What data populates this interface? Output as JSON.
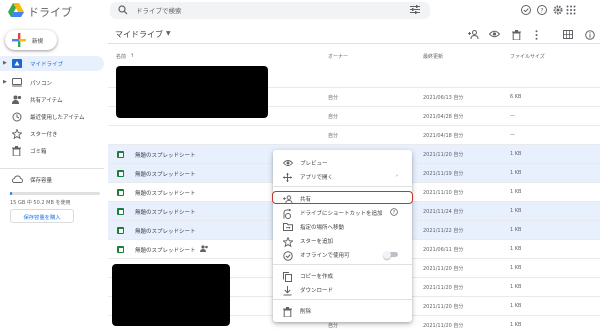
{
  "header": {
    "app_title": "ドライブ",
    "search_placeholder": "ドライブで検索"
  },
  "sidebar": {
    "new_label": "新規",
    "items": [
      {
        "label": "マイドライブ",
        "icon": "my-drive-icon",
        "active": true
      },
      {
        "label": "パソコン",
        "icon": "computer-icon"
      },
      {
        "label": "共有アイテム",
        "icon": "shared-icon"
      },
      {
        "label": "最近使用したアイテム",
        "icon": "clock-icon"
      },
      {
        "label": "スター付き",
        "icon": "star-icon"
      },
      {
        "label": "ゴミ箱",
        "icon": "trash-icon"
      }
    ],
    "storage_label": "保存容量",
    "storage_text": "15 GB 中 50.2 MB を使用",
    "storage_fraction": 0.003,
    "buy_label": "保存容量を購入"
  },
  "main": {
    "title": "マイドライブ",
    "columns": {
      "name": "名前",
      "owner": "オーナー",
      "modified": "最終更新",
      "size": "ファイルサイズ"
    },
    "rows": [
      {
        "name": "",
        "owner": "",
        "modified": "",
        "size": ""
      },
      {
        "name": "",
        "owner": "自分",
        "modified": "2021/06/13 自分",
        "size": "6 KB"
      },
      {
        "name": "",
        "owner": "自分",
        "modified": "2021/04/28 自分",
        "size": "—"
      },
      {
        "name": "",
        "owner": "自分",
        "modified": "2021/04/18 自分",
        "size": "—"
      },
      {
        "name": "無題のスプレッドシート",
        "owner": "自分",
        "modified": "2021/11/20 自分",
        "size": "1 KB",
        "selected": true
      },
      {
        "name": "無題のスプレッドシート",
        "owner": "自分",
        "modified": "2021/11/19 自分",
        "size": "1 KB",
        "selected": true
      },
      {
        "name": "無題のスプレッドシート",
        "owner": "自分",
        "modified": "2021/11/10 自分",
        "size": "1 KB"
      },
      {
        "name": "無題のスプレッドシート",
        "owner": "自分",
        "modified": "2021/11/24 自分",
        "size": "1 KB",
        "selected": true
      },
      {
        "name": "無題のスプレッドシート",
        "owner": "自分",
        "modified": "2021/11/22 自分",
        "size": "1 KB",
        "selected": true
      },
      {
        "name": "無題のスプレッドシート",
        "owner": "自分",
        "modified": "2021/06/11 自分",
        "size": "1 KB",
        "shared": true
      },
      {
        "name": "",
        "owner": "自分",
        "modified": "2021/11/20 自分",
        "size": "1 KB"
      },
      {
        "name": "",
        "owner": "自分",
        "modified": "2021/11/20 自分",
        "size": "1 KB"
      },
      {
        "name": "",
        "owner": "自分",
        "modified": "2021/11/20 自分",
        "size": "1 KB"
      },
      {
        "name": "",
        "owner": "自分",
        "modified": "2021/11/20 自分",
        "size": "1 KB"
      }
    ]
  },
  "context_menu": {
    "items": [
      {
        "label": "プレビュー",
        "icon": "eye-icon"
      },
      {
        "label": "アプリで開く",
        "icon": "move-icon",
        "submenu": true
      },
      {
        "label": "共有",
        "icon": "add-person-icon",
        "highlight": true
      },
      {
        "label": "ドライブにショートカットを追加",
        "icon": "shortcut-icon",
        "help": true
      },
      {
        "label": "指定の場所へ移動",
        "icon": "folder-move-icon"
      },
      {
        "label": "スターを追加",
        "icon": "star-icon"
      },
      {
        "label": "オフラインで使用可",
        "icon": "offline-icon",
        "toggle": false
      },
      {
        "label": "コピーを作成",
        "icon": "copy-icon"
      },
      {
        "label": "ダウンロード",
        "icon": "download-icon"
      },
      {
        "label": "削除",
        "icon": "trash-icon"
      }
    ]
  },
  "colors": {
    "accent": "#1a73e8",
    "selected_row": "#e8f0fe",
    "sheets_green": "#188038",
    "highlight_border": "#c0392b"
  }
}
